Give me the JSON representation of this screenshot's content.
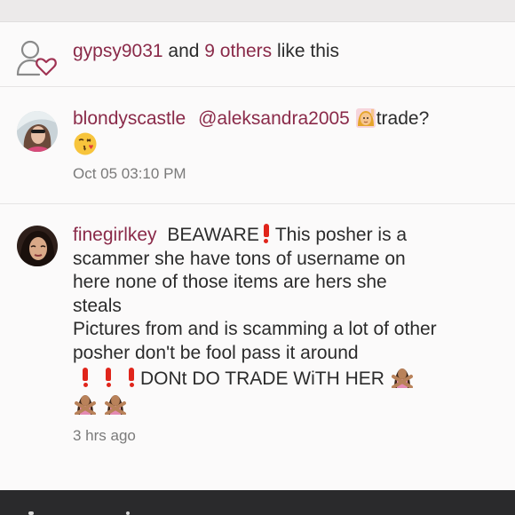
{
  "likes": {
    "first_user": "gypsy9031",
    "and_text": " and ",
    "others_link": "9 others",
    "suffix": " like this"
  },
  "comments": [
    {
      "user": "blondyscastle",
      "mention": "@aleksandra2005",
      "text": "trade?",
      "emojis": [
        "raising-hand-emoji",
        "kiss-face-emoji"
      ],
      "time": "Oct 05 03:10 PM"
    },
    {
      "user": "finegirlkey",
      "text_parts": {
        "warn_word": "BEAWARE",
        "line1_rest": "This posher is a",
        "line2": "scammer she have tons of username on",
        "line3": "here none of those items are hers she",
        "line4": "steals",
        "line5": "Pictures from and is scamming a lot of other",
        "line6": "posher don't be fool  pass it around",
        "line7": "DONt DO TRADE WiTH HER"
      },
      "emojis": [
        "exclamation-emoji",
        "no-gesture-emoji"
      ],
      "time": "3 hrs ago"
    }
  ],
  "colors": {
    "username": "#8a2a49",
    "body_text": "#2b2b2b",
    "timestamp": "#7a7a7a",
    "exclamation": "#e0251b"
  }
}
